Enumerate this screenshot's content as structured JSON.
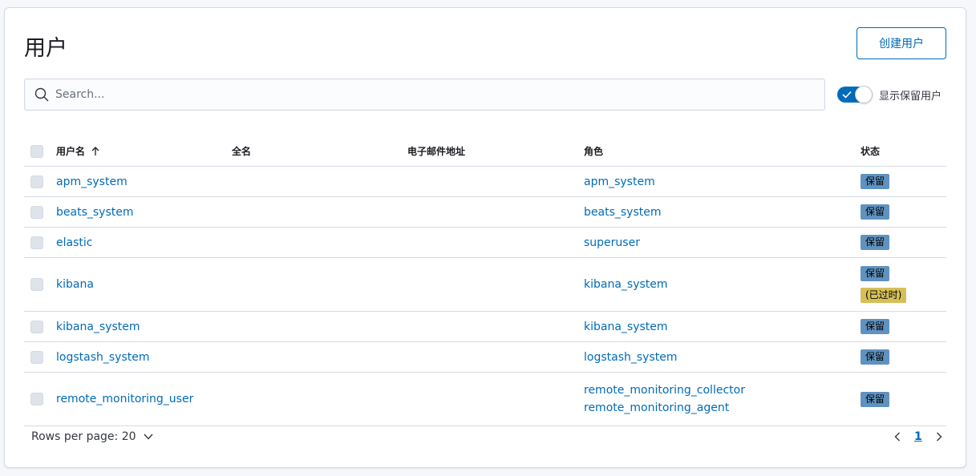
{
  "page": {
    "title": "用户",
    "create_button": "创建用户"
  },
  "search": {
    "placeholder": "Search..."
  },
  "toggle": {
    "label": "显示保留用户",
    "on": true
  },
  "table": {
    "headers": {
      "username": "用户名",
      "full_name": "全名",
      "email": "电子邮件地址",
      "roles": "角色",
      "status": "状态"
    },
    "rows": [
      {
        "username": "apm_system",
        "roles": [
          "apm_system"
        ],
        "badges": [
          "保留"
        ]
      },
      {
        "username": "beats_system",
        "roles": [
          "beats_system"
        ],
        "badges": [
          "保留"
        ]
      },
      {
        "username": "elastic",
        "roles": [
          "superuser"
        ],
        "badges": [
          "保留"
        ]
      },
      {
        "username": "kibana",
        "roles": [
          "kibana_system"
        ],
        "badges": [
          "保留",
          "(已过时)"
        ]
      },
      {
        "username": "kibana_system",
        "roles": [
          "kibana_system"
        ],
        "badges": [
          "保留"
        ]
      },
      {
        "username": "logstash_system",
        "roles": [
          "logstash_system"
        ],
        "badges": [
          "保留"
        ]
      },
      {
        "username": "remote_monitoring_user",
        "roles": [
          "remote_monitoring_collector",
          "remote_monitoring_agent"
        ],
        "badges": [
          "保留"
        ]
      }
    ]
  },
  "footer": {
    "rows_per_page": "Rows per page: 20",
    "current_page": "1"
  },
  "colors": {
    "accent": "#006bb8",
    "reserved_badge": "#6092c0",
    "deprecated_badge": "#d6bf57"
  }
}
